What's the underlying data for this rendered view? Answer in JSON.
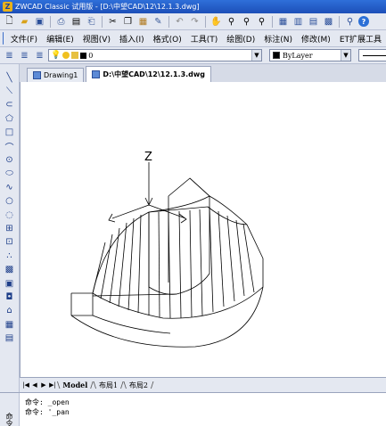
{
  "window": {
    "title": "ZWCAD Classic 试用版 - [D:\\中望CAD\\12\\12.1.3.dwg]"
  },
  "toolbar_icons": [
    "new-icon",
    "open-icon",
    "save-icon",
    "print-icon",
    "preview-icon",
    "publish-icon",
    "cut-icon",
    "copy-icon",
    "paste-icon",
    "matchprop-icon",
    "undo-icon",
    "redo-icon",
    "pan-icon",
    "zoom-realtime-icon",
    "zoom-window-icon",
    "zoom-previous-icon",
    "properties-icon",
    "design-center-icon",
    "tool-palette-icon",
    "calculator-icon",
    "search-icon",
    "help-icon"
  ],
  "menu": {
    "items": [
      "文件(F)",
      "编辑(E)",
      "视图(V)",
      "插入(I)",
      "格式(O)",
      "工具(T)",
      "绘图(D)",
      "标注(N)",
      "修改(M)",
      "ET扩展工具"
    ]
  },
  "layer": {
    "current": "0"
  },
  "color": {
    "current": "ByLayer",
    "swatch": "#000000"
  },
  "left_tools": [
    "line-icon",
    "construction-line-icon",
    "polyline-icon",
    "polygon-icon",
    "rectangle-icon",
    "arc-icon",
    "circle-icon",
    "ellipse-icon",
    "spline-icon",
    "revision-cloud-icon",
    "ellipse-arc-icon",
    "insert-block-icon",
    "make-block-icon",
    "point-icon",
    "hatch-icon",
    "gradient-icon",
    "region-icon",
    "boundary-icon",
    "table-icon",
    "mtext-icon"
  ],
  "doc_tabs": [
    {
      "label": "Drawing1",
      "active": false
    },
    {
      "label": "D:\\中望CAD\\12\\12.1.3.dwg",
      "active": true
    }
  ],
  "drawing": {
    "axis_label": "Z"
  },
  "layout_tabs": [
    {
      "label": "Model",
      "active": true
    },
    {
      "label": "布局1",
      "active": false
    },
    {
      "label": "布局2",
      "active": false
    }
  ],
  "command": {
    "side_label": "命令",
    "lines": [
      "命令: _open",
      "命令: '_pan"
    ]
  }
}
